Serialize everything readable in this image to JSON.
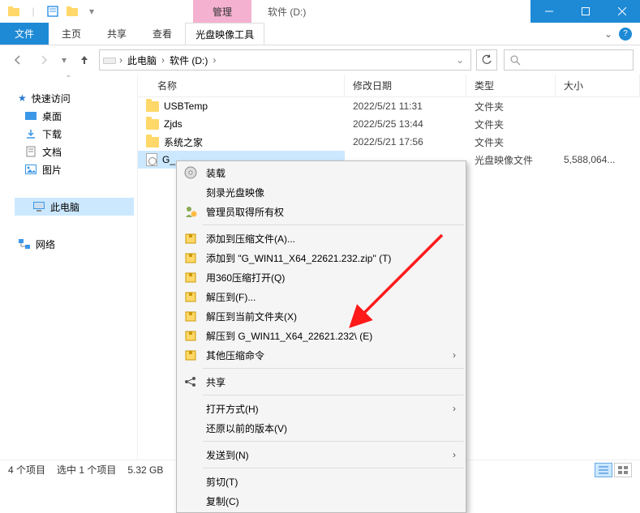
{
  "titlebar": {
    "context_tab": "管理",
    "drive_title": "软件 (D:)"
  },
  "ribbon": {
    "file": "文件",
    "tabs": [
      "主页",
      "共享",
      "查看"
    ],
    "context_tab": "光盘映像工具"
  },
  "address": {
    "root": "此电脑",
    "drive": "软件 (D:)",
    "search_placeholder": ""
  },
  "sidebar": {
    "quick_access": "快速访问",
    "items": [
      "桌面",
      "下载",
      "文档",
      "图片"
    ],
    "this_pc": "此电脑",
    "network": "网络"
  },
  "columns": {
    "name": "名称",
    "date": "修改日期",
    "type": "类型",
    "size": "大小"
  },
  "rows": [
    {
      "name": "USBTemp",
      "date": "2022/5/21 11:31",
      "type": "文件夹",
      "size": "",
      "icon": "folder",
      "selected": false
    },
    {
      "name": "Zjds",
      "date": "2022/5/25 13:44",
      "type": "文件夹",
      "size": "",
      "icon": "folder",
      "selected": false
    },
    {
      "name": "系统之家",
      "date": "2022/5/21 17:56",
      "type": "文件夹",
      "size": "",
      "icon": "folder",
      "selected": false
    },
    {
      "name": "G_",
      "date": "",
      "type": "光盘映像文件",
      "size": "5,588,064...",
      "icon": "iso",
      "selected": true
    }
  ],
  "context_menu": {
    "items": [
      {
        "label": "装载",
        "icon": "disc",
        "sep_after": false
      },
      {
        "label": "刻录光盘映像",
        "icon": "",
        "sep_after": false
      },
      {
        "label": "管理员取得所有权",
        "icon": "admin",
        "sep_after": true
      },
      {
        "label": "添加到压缩文件(A)...",
        "icon": "zip",
        "sep_after": false
      },
      {
        "label": "添加到 \"G_WIN11_X64_22621.232.zip\" (T)",
        "icon": "zip",
        "sep_after": false
      },
      {
        "label": "用360压缩打开(Q)",
        "icon": "zip",
        "sep_after": false
      },
      {
        "label": "解压到(F)...",
        "icon": "zip",
        "sep_after": false
      },
      {
        "label": "解压到当前文件夹(X)",
        "icon": "zip",
        "sep_after": false
      },
      {
        "label": "解压到 G_WIN11_X64_22621.232\\ (E)",
        "icon": "zip",
        "sep_after": false
      },
      {
        "label": "其他压缩命令",
        "icon": "zip",
        "submenu": true,
        "sep_after": true
      },
      {
        "label": "共享",
        "icon": "share",
        "sep_after": true
      },
      {
        "label": "打开方式(H)",
        "icon": "",
        "indent": true,
        "submenu": true,
        "sep_after": false
      },
      {
        "label": "还原以前的版本(V)",
        "icon": "",
        "indent": true,
        "sep_after": true
      },
      {
        "label": "发送到(N)",
        "icon": "",
        "indent": true,
        "submenu": true,
        "sep_after": true
      },
      {
        "label": "剪切(T)",
        "icon": "",
        "indent": true,
        "sep_after": false
      },
      {
        "label": "复制(C)",
        "icon": "",
        "indent": true,
        "sep_after": false
      }
    ]
  },
  "statusbar": {
    "count": "4 个项目",
    "selection": "选中 1 个项目",
    "size": "5.32 GB"
  }
}
